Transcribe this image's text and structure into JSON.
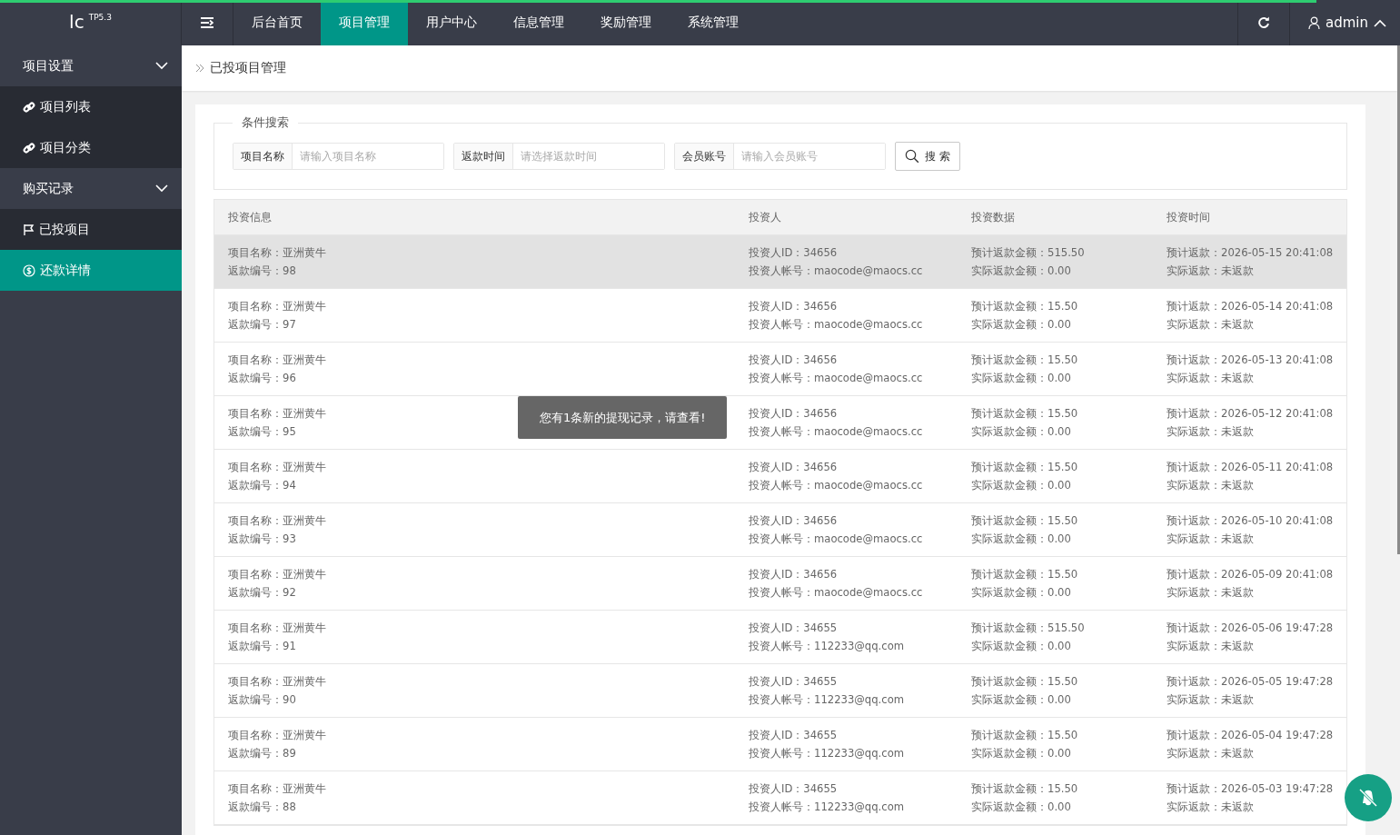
{
  "loading_bar": {
    "level": 0.94
  },
  "logo": {
    "text": "lc",
    "version": "TP5.3"
  },
  "top_nav": [
    {
      "label": "后台首页",
      "selected": false
    },
    {
      "label": "项目管理",
      "selected": true
    },
    {
      "label": "用户中心",
      "selected": false
    },
    {
      "label": "信息管理",
      "selected": false
    },
    {
      "label": "奖励管理",
      "selected": false
    },
    {
      "label": "系统管理",
      "selected": false
    }
  ],
  "user": {
    "name": "admin"
  },
  "sidebar": [
    {
      "label": "项目设置",
      "expanded": true,
      "children": [
        {
          "label": "项目列表",
          "kind": "link",
          "selected": false
        },
        {
          "label": "项目分类",
          "kind": "link",
          "selected": false
        }
      ]
    },
    {
      "label": "购买记录",
      "expanded": true,
      "children": [
        {
          "label": "已投项目",
          "kind": "flag",
          "selected": false
        },
        {
          "label": "还款详情",
          "kind": "dollar",
          "selected": true
        }
      ]
    }
  ],
  "breadcrumb": "已投项目管理",
  "search": {
    "legend": "条件搜索",
    "fields": [
      {
        "label": "项目名称",
        "placeholder": "请输入项目名称"
      },
      {
        "label": "返款时间",
        "placeholder": "请选择返款时间"
      },
      {
        "label": "会员账号",
        "placeholder": "请输入会员账号"
      }
    ],
    "button": "搜 索"
  },
  "table": {
    "columns": [
      "投资信息",
      "投资人",
      "投资数据",
      "投资时间"
    ],
    "rows": [
      {
        "highlighted": true,
        "cells": [
          [
            "项目名称：亚洲黄牛",
            "返款编号：98"
          ],
          [
            "投资人ID：34656",
            "投资人帐号：maocode@maocs.cc"
          ],
          [
            "预计返款金额：515.50",
            "实际返款金额：0.00"
          ],
          [
            "预计返款：2026-05-15 20:41:08",
            "实际返款：未返款"
          ]
        ]
      },
      {
        "highlighted": false,
        "cells": [
          [
            "项目名称：亚洲黄牛",
            "返款编号：97"
          ],
          [
            "投资人ID：34656",
            "投资人帐号：maocode@maocs.cc"
          ],
          [
            "预计返款金额：15.50",
            "实际返款金额：0.00"
          ],
          [
            "预计返款：2026-05-14 20:41:08",
            "实际返款：未返款"
          ]
        ]
      },
      {
        "highlighted": false,
        "cells": [
          [
            "项目名称：亚洲黄牛",
            "返款编号：96"
          ],
          [
            "投资人ID：34656",
            "投资人帐号：maocode@maocs.cc"
          ],
          [
            "预计返款金额：15.50",
            "实际返款金额：0.00"
          ],
          [
            "预计返款：2026-05-13 20:41:08",
            "实际返款：未返款"
          ]
        ]
      },
      {
        "highlighted": false,
        "cells": [
          [
            "项目名称：亚洲黄牛",
            "返款编号：95"
          ],
          [
            "投资人ID：34656",
            "投资人帐号：maocode@maocs.cc"
          ],
          [
            "预计返款金额：15.50",
            "实际返款金额：0.00"
          ],
          [
            "预计返款：2026-05-12 20:41:08",
            "实际返款：未返款"
          ]
        ]
      },
      {
        "highlighted": false,
        "cells": [
          [
            "项目名称：亚洲黄牛",
            "返款编号：94"
          ],
          [
            "投资人ID：34656",
            "投资人帐号：maocode@maocs.cc"
          ],
          [
            "预计返款金额：15.50",
            "实际返款金额：0.00"
          ],
          [
            "预计返款：2026-05-11 20:41:08",
            "实际返款：未返款"
          ]
        ]
      },
      {
        "highlighted": false,
        "cells": [
          [
            "项目名称：亚洲黄牛",
            "返款编号：93"
          ],
          [
            "投资人ID：34656",
            "投资人帐号：maocode@maocs.cc"
          ],
          [
            "预计返款金额：15.50",
            "实际返款金额：0.00"
          ],
          [
            "预计返款：2026-05-10 20:41:08",
            "实际返款：未返款"
          ]
        ]
      },
      {
        "highlighted": false,
        "cells": [
          [
            "项目名称：亚洲黄牛",
            "返款编号：92"
          ],
          [
            "投资人ID：34656",
            "投资人帐号：maocode@maocs.cc"
          ],
          [
            "预计返款金额：15.50",
            "实际返款金额：0.00"
          ],
          [
            "预计返款：2026-05-09 20:41:08",
            "实际返款：未返款"
          ]
        ]
      },
      {
        "highlighted": false,
        "cells": [
          [
            "项目名称：亚洲黄牛",
            "返款编号：91"
          ],
          [
            "投资人ID：34655",
            "投资人帐号：112233@qq.com"
          ],
          [
            "预计返款金额：515.50",
            "实际返款金额：0.00"
          ],
          [
            "预计返款：2026-05-06 19:47:28",
            "实际返款：未返款"
          ]
        ]
      },
      {
        "highlighted": false,
        "cells": [
          [
            "项目名称：亚洲黄牛",
            "返款编号：90"
          ],
          [
            "投资人ID：34655",
            "投资人帐号：112233@qq.com"
          ],
          [
            "预计返款金额：15.50",
            "实际返款金额：0.00"
          ],
          [
            "预计返款：2026-05-05 19:47:28",
            "实际返款：未返款"
          ]
        ]
      },
      {
        "highlighted": false,
        "cells": [
          [
            "项目名称：亚洲黄牛",
            "返款编号：89"
          ],
          [
            "投资人ID：34655",
            "投资人帐号：112233@qq.com"
          ],
          [
            "预计返款金额：15.50",
            "实际返款金额：0.00"
          ],
          [
            "预计返款：2026-05-04 19:47:28",
            "实际返款：未返款"
          ]
        ]
      },
      {
        "highlighted": false,
        "cells": [
          [
            "项目名称：亚洲黄牛",
            "返款编号：88"
          ],
          [
            "投资人ID：34655",
            "投资人帐号：112233@qq.com"
          ],
          [
            "预计返款金额：15.50",
            "实际返款金额：0.00"
          ],
          [
            "预计返款：2026-05-03 19:47:28",
            "实际返款：未返款"
          ]
        ]
      }
    ]
  },
  "toast": "您有1条新的提现记录，请查看!"
}
